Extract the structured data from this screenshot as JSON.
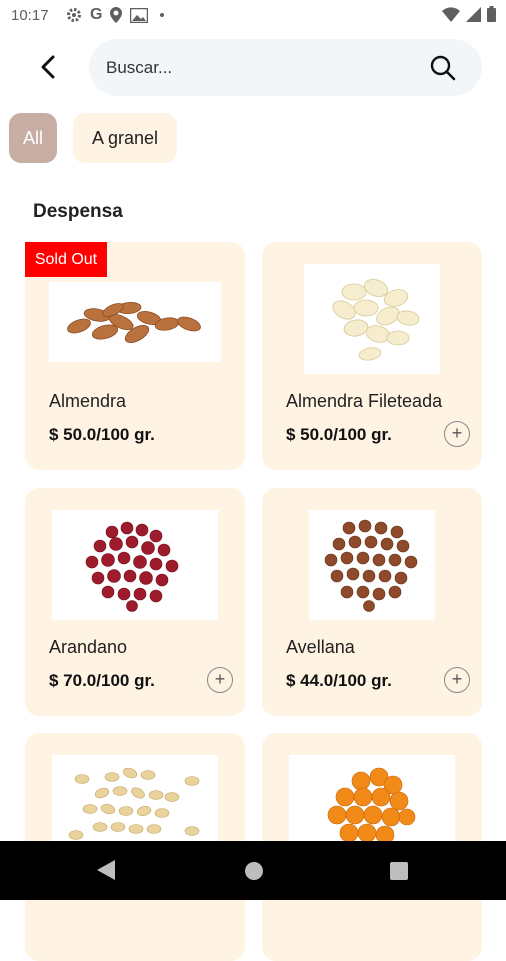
{
  "status_bar": {
    "time": "10:17"
  },
  "search": {
    "placeholder": "Buscar..."
  },
  "filters": [
    {
      "label": "All"
    },
    {
      "label": "A granel"
    }
  ],
  "section": {
    "title": "Despensa"
  },
  "products": [
    {
      "name": "Almendra",
      "price": "$ 50.0/100 gr.",
      "badge": "Sold Out",
      "image": "almonds-image"
    },
    {
      "name": "Almendra Fileteada",
      "price": "$ 50.0/100 gr.",
      "image": "sliced-almonds-image"
    },
    {
      "name": "Arandano",
      "price": "$ 70.0/100 gr.",
      "image": "cranberries-image"
    },
    {
      "name": "Avellana",
      "price": "$ 44.0/100 gr.",
      "image": "hazelnuts-image"
    },
    {
      "name": "",
      "price": "",
      "image": "peanuts-image"
    },
    {
      "name": "",
      "price": "",
      "image": "dried-apricots-image"
    }
  ],
  "colors": {
    "card_bg": "#fff3e3",
    "chip_all": "#c6aea4",
    "chip_granel": "#fff3e4",
    "sold_out": "#ff0000",
    "search_bg": "#f3f6f8"
  },
  "icons": [
    "back-arrow-icon",
    "search-icon",
    "add-circle-icon",
    "settings-icon",
    "google-icon",
    "location-icon",
    "photo-icon",
    "wifi-icon",
    "signal-icon",
    "battery-icon",
    "nav-back-icon",
    "nav-home-icon",
    "nav-recents-icon"
  ]
}
